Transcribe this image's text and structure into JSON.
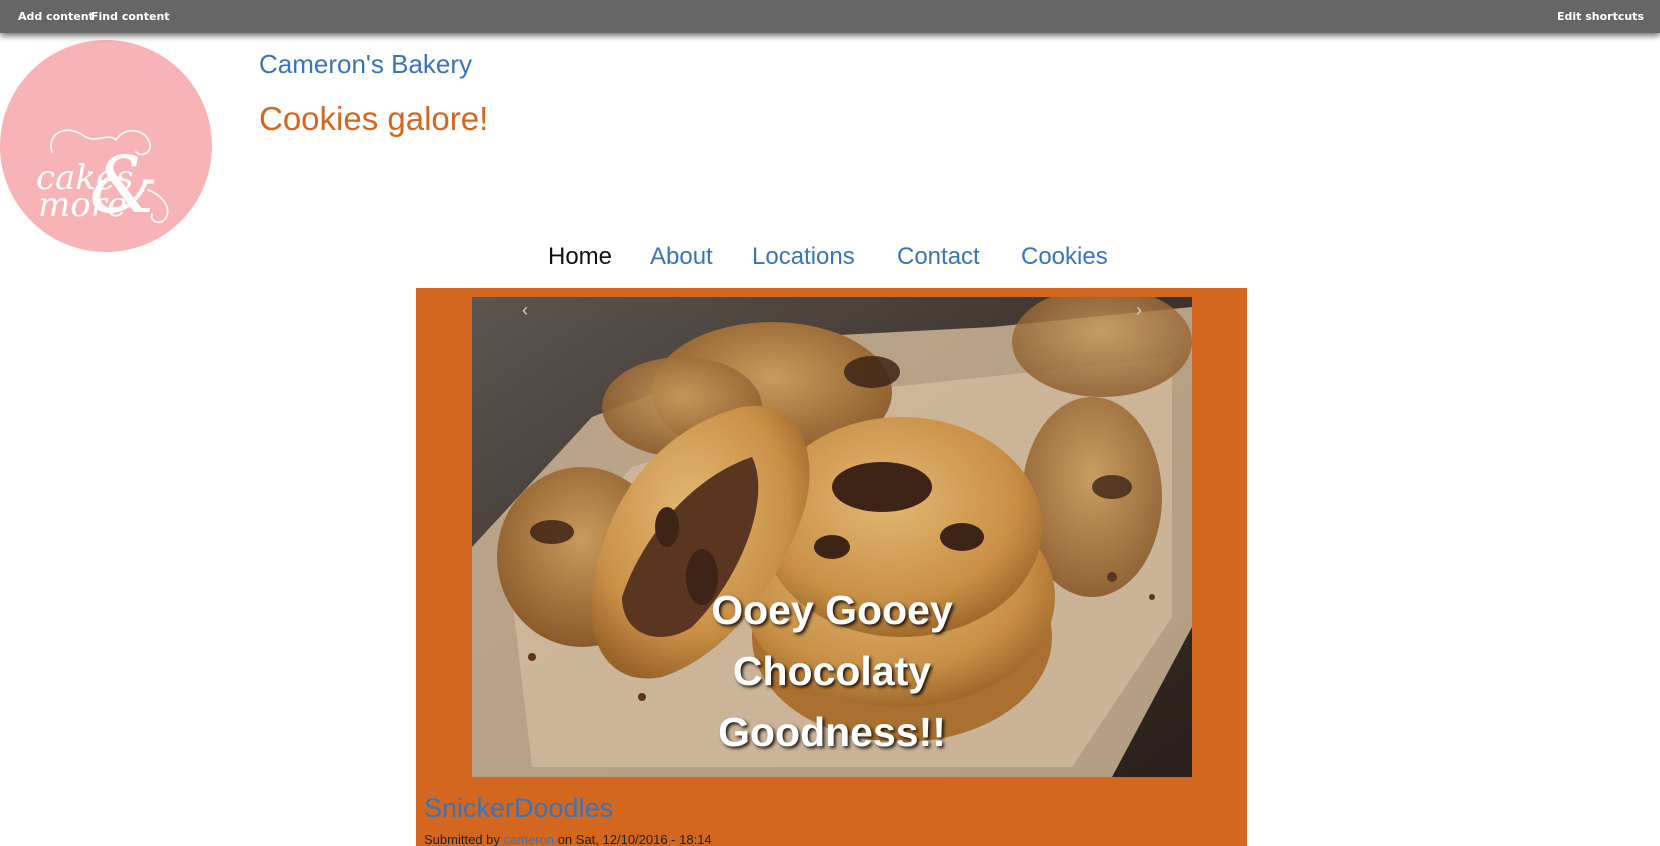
{
  "toolbar": {
    "add_content": "Add content",
    "find_content": "Find content",
    "edit_shortcuts": "Edit shortcuts"
  },
  "logo": {
    "line1": "cakes",
    "line2": "more",
    "ampersand": "&"
  },
  "site": {
    "name": "Cameron's Bakery",
    "slogan": "Cookies galore!"
  },
  "nav": {
    "items": [
      {
        "label": "Home",
        "active": true
      },
      {
        "label": "About",
        "active": false
      },
      {
        "label": "Locations",
        "active": false
      },
      {
        "label": "Contact",
        "active": false
      },
      {
        "label": "Cookies",
        "active": false
      }
    ]
  },
  "slider": {
    "prev": "‹",
    "next": "›",
    "caption_lines": [
      "Ooey Gooey",
      "Chocolaty",
      "Goodness!!"
    ]
  },
  "node": {
    "title": "SnickerDoodles",
    "submitted_prefix": "Submitted by",
    "author": "cameron",
    "date_text": "on Sat, 12/10/2016 - 18:14"
  },
  "colors": {
    "toolbar_bg": "#666666",
    "link_blue": "#3b73b9",
    "accent_orange": "#d3671f",
    "logo_pink": "#f7b3b6"
  }
}
